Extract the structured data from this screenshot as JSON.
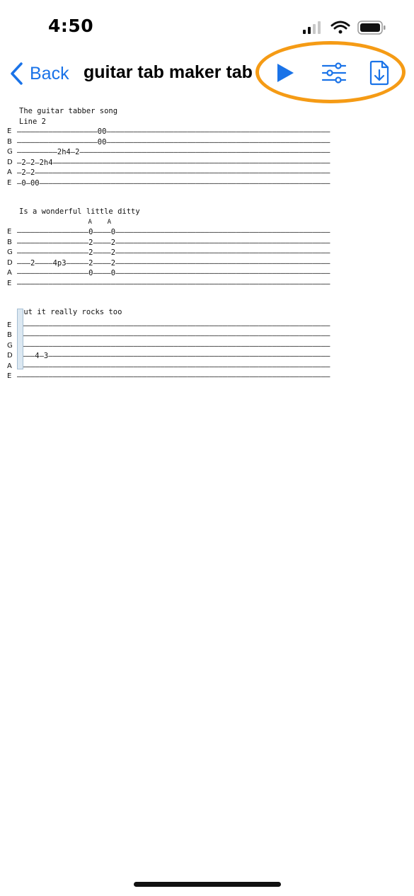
{
  "status_bar": {
    "time": "4:50"
  },
  "nav": {
    "back_label": "Back",
    "title": "guitar tab maker tab",
    "icons": {
      "back": "chevron-left-icon",
      "play": "play-icon",
      "settings": "sliders-icon",
      "export": "document-download-icon"
    },
    "accent_color": "#1a73e8",
    "highlight_color": "#f59b15"
  },
  "tab": {
    "blocks": [
      {
        "texts": [
          "The guitar tabber song",
          "Line 2"
        ],
        "lines": [
          {
            "string": "E",
            "content": "——————————————————00——————————————————————————————————————————————————"
          },
          {
            "string": "B",
            "content": "——————————————————00——————————————————————————————————————————————————"
          },
          {
            "string": "G",
            "content": "—————————2h4—2————————————————————————————————————————————————————————"
          },
          {
            "string": "D",
            "content": "—2—2—2h4——————————————————————————————————————————————————————————————"
          },
          {
            "string": "A",
            "content": "—2—2——————————————————————————————————————————————————————————————————"
          },
          {
            "string": "E",
            "content": "—0—00—————————————————————————————————————————————————————————————————"
          }
        ]
      },
      {
        "texts": [
          "Is a wonderful little ditty"
        ],
        "annotation": "                  A    A",
        "lines": [
          {
            "string": "E",
            "content": "————————————————0————0————————————————————————————————————————————————"
          },
          {
            "string": "B",
            "content": "————————————————2————2————————————————————————————————————————————————"
          },
          {
            "string": "G",
            "content": "————————————————2————2————————————————————————————————————————————————"
          },
          {
            "string": "D",
            "content": "———2————4p3—————2————2————————————————————————————————————————————————"
          },
          {
            "string": "A",
            "content": "————————————————0————0————————————————————————————————————————————————"
          },
          {
            "string": "E",
            "content": "——————————————————————————————————————————————————————————————————————"
          }
        ]
      },
      {
        "texts": [
          "But it really rocks too"
        ],
        "lines": [
          {
            "string": "E",
            "content": "——————————————————————————————————————————————————————————————————————"
          },
          {
            "string": "B",
            "content": "——————————————————————————————————————————————————————————————————————"
          },
          {
            "string": "G",
            "content": "——————————————————————————————————————————————————————————————————————"
          },
          {
            "string": "D",
            "content": "————4—3———————————————————————————————————————————————————————————————"
          },
          {
            "string": "A",
            "content": "——————————————————————————————————————————————————————————————————————"
          },
          {
            "string": "E",
            "content": "——————————————————————————————————————————————————————————————————————"
          }
        ]
      }
    ]
  }
}
